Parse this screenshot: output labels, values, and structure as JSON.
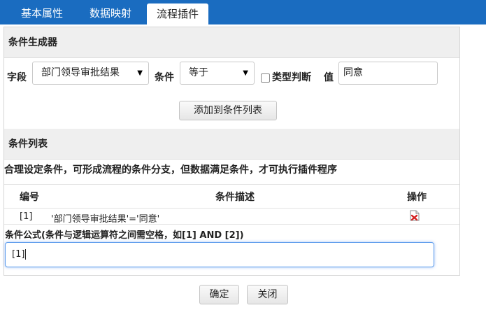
{
  "tabs": [
    {
      "label": "基本属性",
      "active": false
    },
    {
      "label": "数据映射",
      "active": false
    },
    {
      "label": "流程插件",
      "active": true
    }
  ],
  "generator": {
    "title": "条件生成器",
    "field_label": "字段",
    "field_value": "部门领导审批结果",
    "condition_label": "条件",
    "condition_value": "等于",
    "type_check_label": "类型判断",
    "type_check_checked": false,
    "value_label": "值",
    "value_value": "同意",
    "add_button": "添加到条件列表"
  },
  "condition_list": {
    "title": "条件列表",
    "description": "合理设定条件，可形成流程的条件分支，但数据满足条件，才可执行插件程序",
    "columns": [
      "编号",
      "条件描述",
      "操作"
    ],
    "rows": [
      {
        "id": "[1]",
        "description": "'部门领导审批结果'='同意'"
      }
    ]
  },
  "formula": {
    "label": "条件公式(条件与逻辑运算符之间需空格，如[1] AND [2])",
    "value": "[1]"
  },
  "footer": {
    "confirm": "确定",
    "close": "关闭"
  },
  "colors": {
    "tab_bar": "#1a6cc0",
    "section_bg": "#efefef",
    "focus_border": "#5d9cec"
  }
}
